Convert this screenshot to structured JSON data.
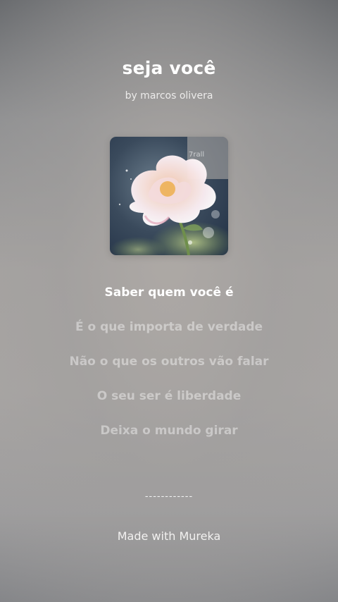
{
  "song": {
    "title": "seja você",
    "artist": "by marcos olivera"
  },
  "cover": {
    "icon": "flower-artwork",
    "watermark": "7rall"
  },
  "lyrics": {
    "lines": [
      "Saber quem você é",
      "É o que importa de verdade",
      "Não o que os outros vão falar",
      "O seu ser é liberdade",
      "Deixa o mundo girar"
    ],
    "active_line": 0
  },
  "footer": {
    "divider": "------------",
    "made_with": "Made with Mureka"
  }
}
